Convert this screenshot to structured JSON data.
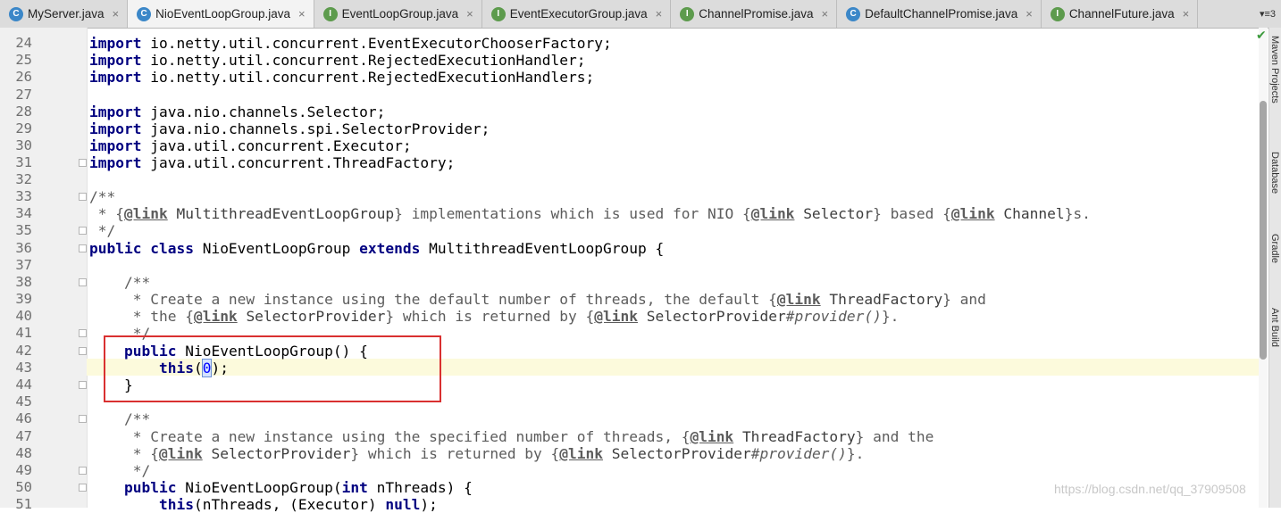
{
  "tabs": [
    {
      "label": "MyServer.java",
      "icon": "class-icon",
      "active": false,
      "closable": true
    },
    {
      "label": "NioEventLoopGroup.java",
      "icon": "class-icon",
      "active": true,
      "closable": true
    },
    {
      "label": "EventLoopGroup.java",
      "icon": "interface-icon",
      "active": false,
      "closable": true
    },
    {
      "label": "EventExecutorGroup.java",
      "icon": "interface-icon",
      "active": false,
      "closable": true
    },
    {
      "label": "ChannelPromise.java",
      "icon": "interface-icon",
      "active": false,
      "closable": true
    },
    {
      "label": "DefaultChannelPromise.java",
      "icon": "class-icon",
      "active": false,
      "closable": true
    },
    {
      "label": "ChannelFuture.java",
      "icon": "interface-icon",
      "active": false,
      "closable": true
    }
  ],
  "tab_overflow": "▾≡3",
  "line_numbers": [
    "24",
    "25",
    "26",
    "27",
    "28",
    "29",
    "30",
    "31",
    "32",
    "33",
    "34",
    "35",
    "36",
    "37",
    "38",
    "39",
    "40",
    "41",
    "42",
    "43",
    "44",
    "45",
    "46",
    "47",
    "48",
    "49",
    "50",
    "51"
  ],
  "code": {
    "l24": "import io.netty.util.concurrent.EventExecutorChooserFactory;",
    "l25": "import io.netty.util.concurrent.RejectedExecutionHandler;",
    "l26": "import io.netty.util.concurrent.RejectedExecutionHandlers;",
    "l28": "import java.nio.channels.Selector;",
    "l29": "import java.nio.channels.spi.SelectorProvider;",
    "l30": "import java.util.concurrent.Executor;",
    "l31": "import java.util.concurrent.ThreadFactory;",
    "l33": "/**",
    "l34": " * {@link MultithreadEventLoopGroup} implementations which is used for NIO {@link Selector} based {@link Channel}s.",
    "l35": " */",
    "l36": "public class NioEventLoopGroup extends MultithreadEventLoopGroup {",
    "l38": "    /**",
    "l39": "     * Create a new instance using the default number of threads, the default {@link ThreadFactory} and",
    "l40": "     * the {@link SelectorProvider} which is returned by {@link SelectorProvider#provider()}.",
    "l41": "     */",
    "l42": "    public NioEventLoopGroup() {",
    "l43": "        this(0);",
    "l44": "    }",
    "l46": "    /**",
    "l47": "     * Create a new instance using the specified number of threads, {@link ThreadFactory} and the",
    "l48": "     * {@link SelectorProvider} which is returned by {@link SelectorProvider#provider()}.",
    "l49": "     */",
    "l50": "    public NioEventLoopGroup(int nThreads) {",
    "l51": "        this(nThreads, (Executor) null);"
  },
  "side_tools": [
    "Maven Projects",
    "Database",
    "Gradle",
    "Ant Build"
  ],
  "watermark": "https://blog.csdn.net/qq_37909508",
  "colors": {
    "keyword": "#000080",
    "number": "#0000ff",
    "highlight_box": "#d93030",
    "current_line": "#fcfadc"
  }
}
